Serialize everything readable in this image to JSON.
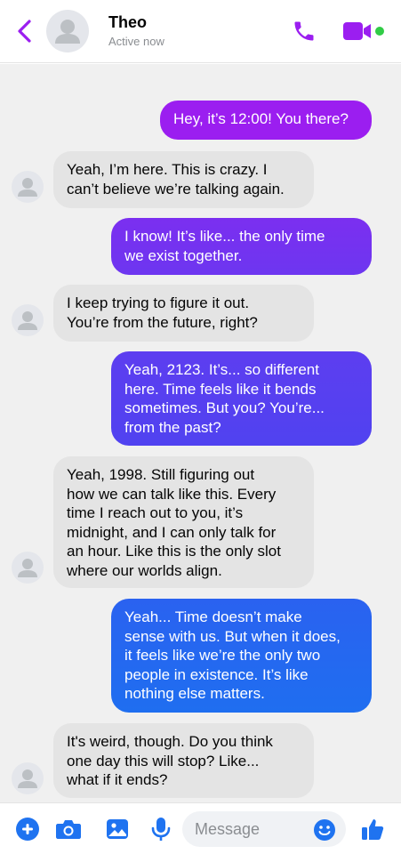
{
  "header": {
    "contact_name": "Theo",
    "status": "Active now",
    "back_icon": "chevron-left-icon",
    "call_icon": "phone-icon",
    "video_icon": "video-camera-icon"
  },
  "colors": {
    "accent_purple": "#9b1ef0",
    "bubble_gradient_top": "#9b1ef0",
    "bubble_gradient_bottom": "#1f73f0",
    "incoming_bubble": "#e4e4e4",
    "active_green": "#31cc46"
  },
  "messages": [
    {
      "direction": "outgoing",
      "text": "Hey, it’s 12:00! You there?"
    },
    {
      "direction": "incoming",
      "text": "Yeah, I’m here. This is crazy. I\ncan’t believe we’re talking again."
    },
    {
      "direction": "outgoing",
      "text": "I know! It’s like... the only time\nwe exist together."
    },
    {
      "direction": "incoming",
      "text": "I keep trying to figure it out.\nYou’re from the future, right?"
    },
    {
      "direction": "outgoing",
      "text": "Yeah, 2123. It’s... so different\nhere. Time feels like it bends\nsometimes. But you? You’re...\nfrom the past?"
    },
    {
      "direction": "incoming",
      "text": "Yeah, 1998. Still figuring out\nhow we can talk like this. Every\ntime I reach out to you, it’s\nmidnight, and I can only talk for\nan hour. Like this is the only slot\nwhere our worlds align."
    },
    {
      "direction": "outgoing",
      "text": "Yeah... Time doesn’t make\nsense with us. But when it does,\nit feels like we’re the only two\npeople in existence. It’s like\nnothing else matters."
    },
    {
      "direction": "incoming",
      "text": "It's weird, though. Do you think\none day this will stop? Like...\nwhat if it ends?"
    }
  ],
  "composer": {
    "placeholder": "Message",
    "value": "",
    "icons": [
      "plus-icon",
      "camera-icon",
      "image-icon",
      "microphone-icon",
      "emoji-icon",
      "thumbs-up-icon"
    ]
  }
}
